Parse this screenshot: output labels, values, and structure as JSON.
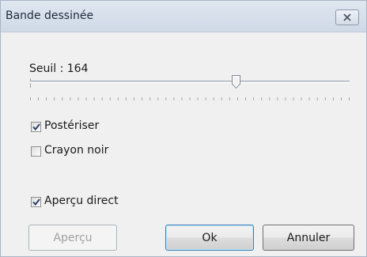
{
  "window": {
    "title": "Bande dessinée"
  },
  "threshold": {
    "label": "Seuil : 164",
    "value": 164
  },
  "options": {
    "posterize": {
      "label": "Postériser",
      "checked": true
    },
    "black_pencil": {
      "label": "Crayon noir",
      "checked": false
    },
    "live_preview": {
      "label": "Aperçu direct",
      "checked": true
    }
  },
  "buttons": {
    "preview": "Aperçu",
    "ok": "Ok",
    "cancel": "Annuler"
  }
}
